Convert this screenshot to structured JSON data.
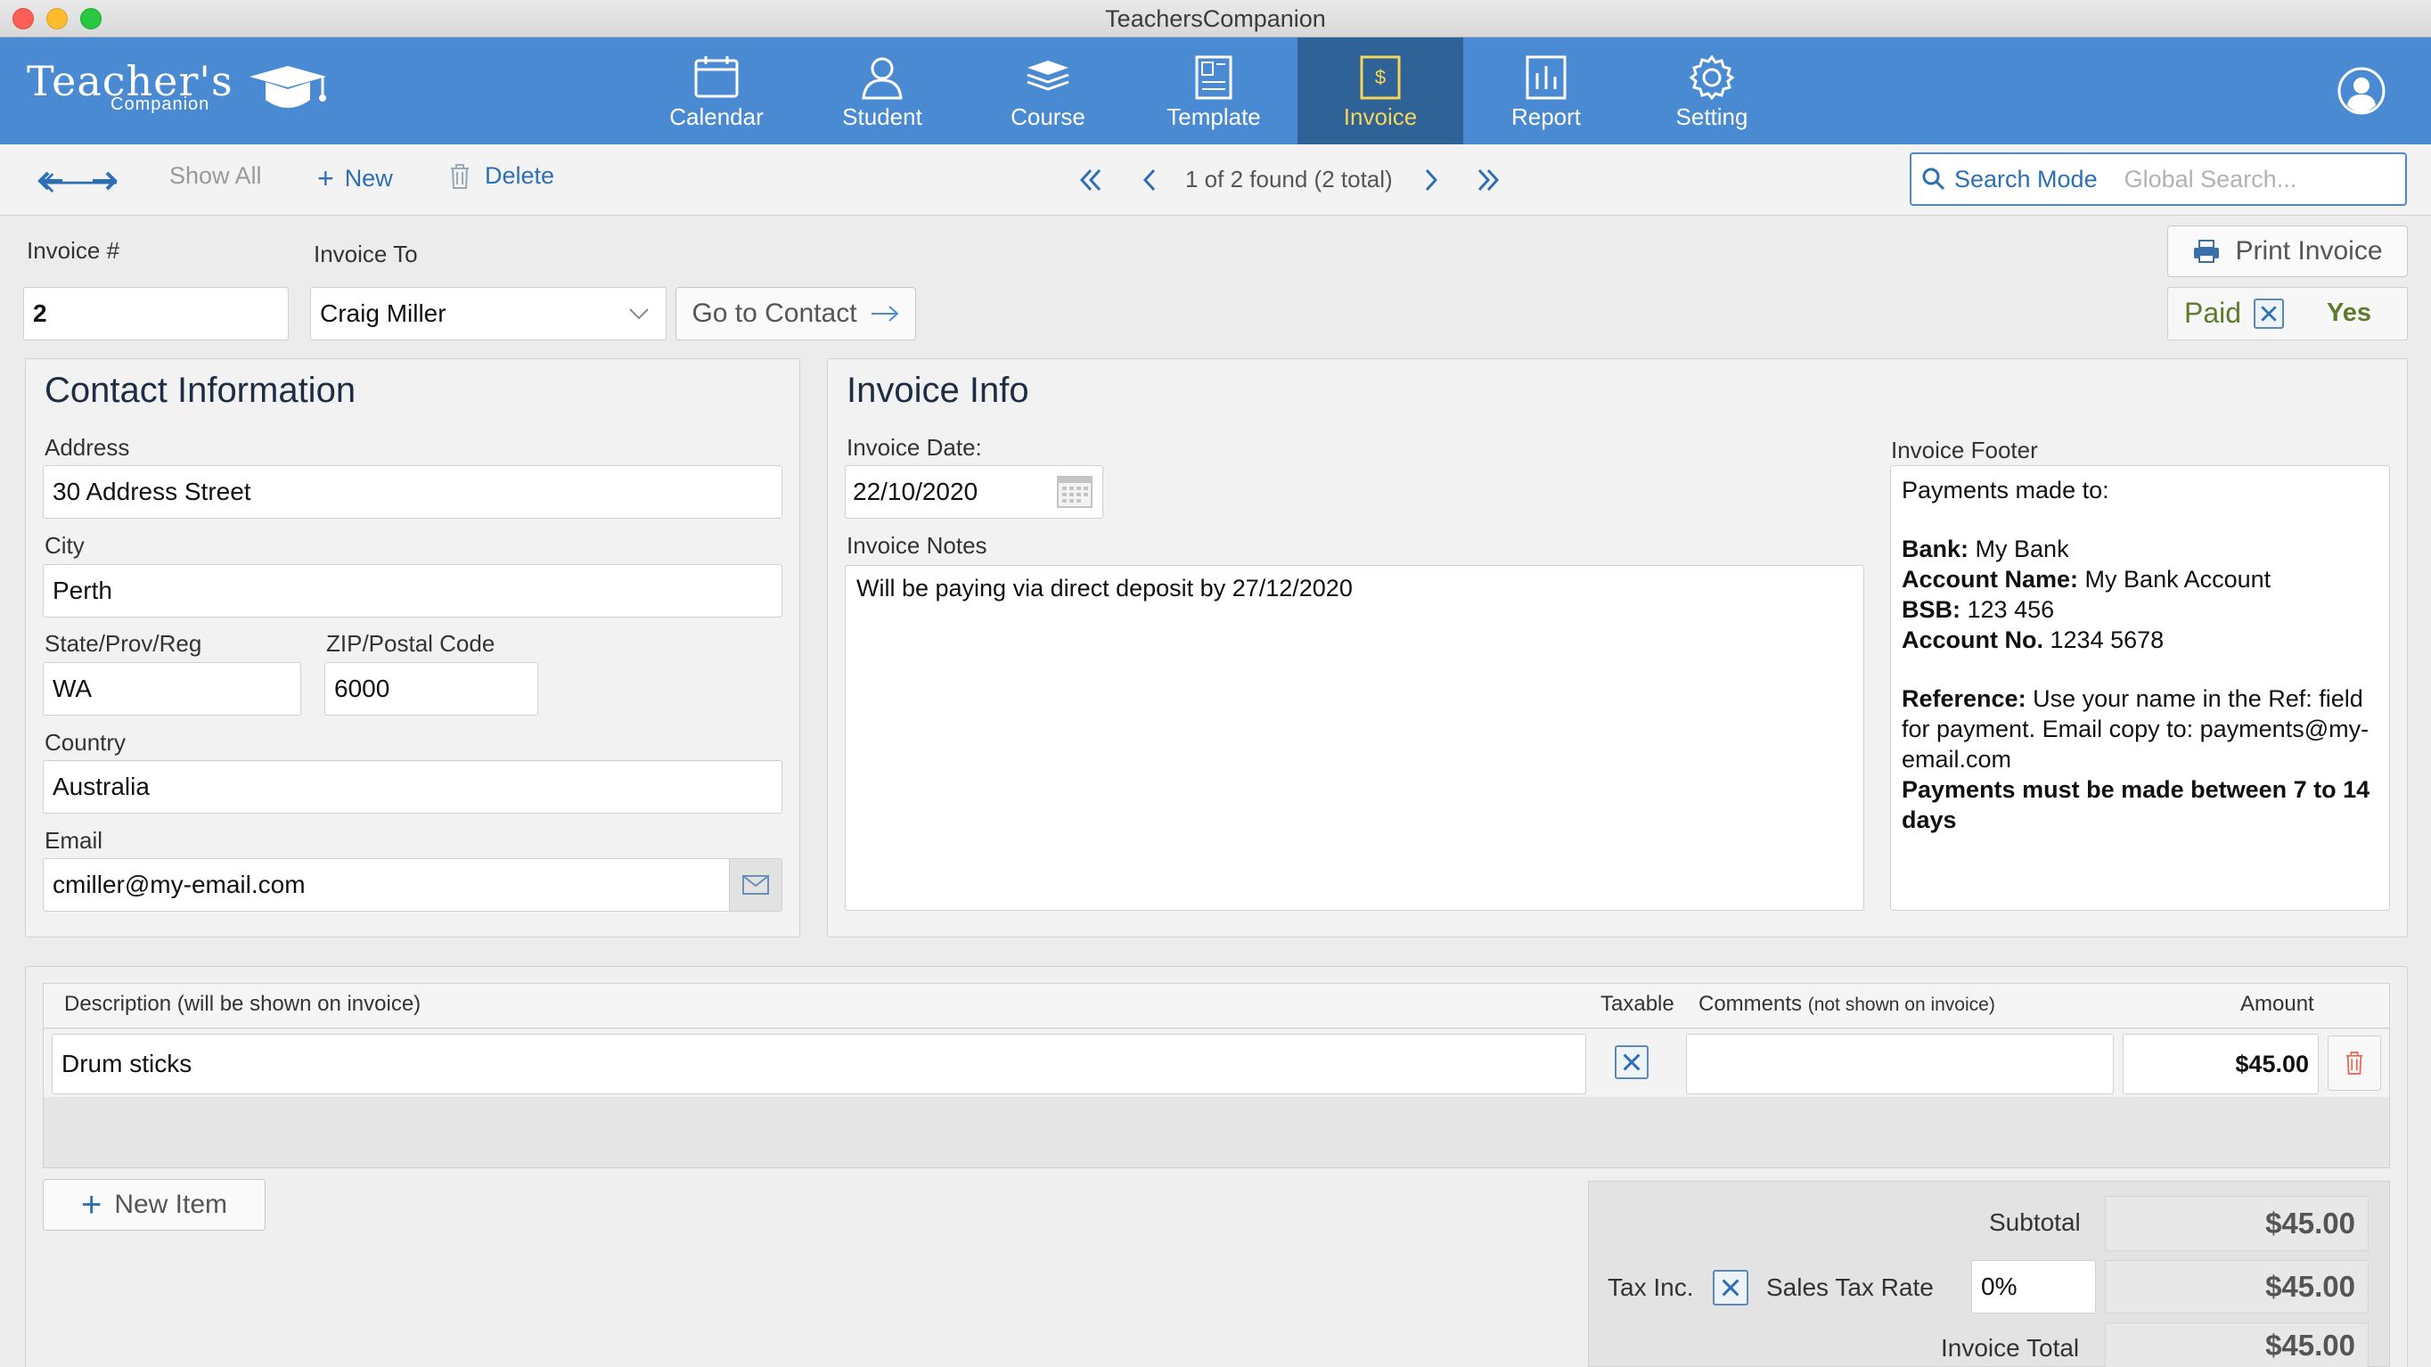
{
  "window": {
    "title": "TeachersCompanion"
  },
  "logo": {
    "main": "Teacher's",
    "sub": "Companion"
  },
  "nav": {
    "tabs": [
      {
        "label": "Calendar",
        "icon": "calendar-icon"
      },
      {
        "label": "Student",
        "icon": "student-icon"
      },
      {
        "label": "Course",
        "icon": "course-icon"
      },
      {
        "label": "Template",
        "icon": "template-icon"
      },
      {
        "label": "Invoice",
        "icon": "invoice-icon",
        "active": true
      },
      {
        "label": "Report",
        "icon": "report-icon"
      },
      {
        "label": "Setting",
        "icon": "gear-icon"
      }
    ]
  },
  "toolbar": {
    "show_all": "Show All",
    "new": "New",
    "delete": "Delete",
    "found": "1 of 2 found (2 total)",
    "search_mode": "Search Mode",
    "search_placeholder": "Global Search..."
  },
  "invoice": {
    "number_label": "Invoice #",
    "number": "2",
    "to_label": "Invoice To",
    "to": "Craig Miller",
    "go_to_contact": "Go to Contact",
    "print": "Print Invoice",
    "paid_label": "Paid",
    "paid_value": "Yes"
  },
  "contact": {
    "title": "Contact Information",
    "address_label": "Address",
    "address": "30 Address Street",
    "city_label": "City",
    "city": "Perth",
    "state_label": "State/Prov/Reg",
    "state": "WA",
    "zip_label": "ZIP/Postal Code",
    "zip": "6000",
    "country_label": "Country",
    "country": "Australia",
    "email_label": "Email",
    "email": "cmiller@my-email.com"
  },
  "info": {
    "title": "Invoice Info",
    "date_label": "Invoice Date:",
    "date": "22/10/2020",
    "notes_label": "Invoice Notes",
    "notes": "Will be paying via direct deposit by 27/12/2020",
    "footer_label": "Invoice Footer",
    "footer": {
      "intro": "Payments made to:",
      "bank_label": "Bank:",
      "bank": "My Bank",
      "account_name_label": "Account Name:",
      "account_name": "My Bank Account",
      "bsb_label": "BSB:",
      "bsb": "123 456",
      "account_no_label": "Account No.",
      "account_no": "1234 5678",
      "reference_label": "Reference:",
      "reference": "Use your name in the Ref: field for payment. Email copy to: payments@my-email.com",
      "terms": "Payments must be made between 7 to 14 days"
    }
  },
  "items": {
    "col_description": "Description (will be shown on invoice)",
    "col_taxable": "Taxable",
    "col_comments": "Comments",
    "col_comments_note": "(not shown on invoice)",
    "col_amount": "Amount",
    "rows": [
      {
        "description": "Drum sticks",
        "taxable": true,
        "comments": "",
        "amount": "$45.00"
      }
    ],
    "new_item": "New Item"
  },
  "totals": {
    "subtotal_label": "Subtotal",
    "subtotal": "$45.00",
    "tax_inc_label": "Tax Inc.",
    "sales_tax_label": "Sales Tax Rate",
    "sales_tax_rate": "0%",
    "tax_amount": "$45.00",
    "total_label": "Invoice Total",
    "total": "$45.00"
  },
  "colors": {
    "header": "#4a8ad2",
    "active_tab": "#2f6398",
    "link": "#2d6fb5",
    "paid_green": "#5f7a2c"
  }
}
